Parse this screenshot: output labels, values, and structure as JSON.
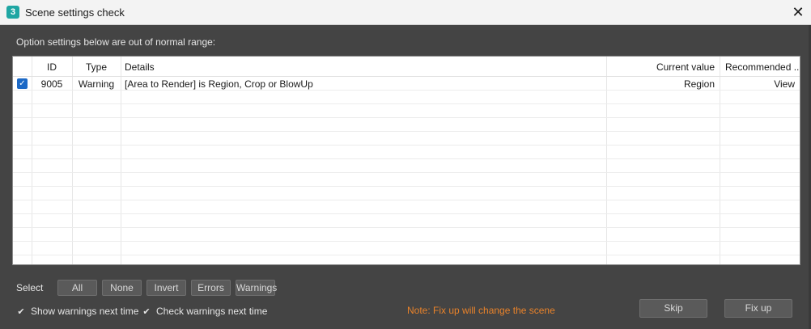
{
  "window": {
    "title": "Scene settings check",
    "app_icon_glyph": "3",
    "close_glyph": "✕"
  },
  "info_text": "Option settings below are out of normal range:",
  "table": {
    "columns": [
      "ID",
      "Type",
      "Details",
      "Current value",
      "Recommended ..."
    ],
    "rows": [
      {
        "checked": true,
        "id": "9005",
        "type": "Warning",
        "details": "[Area to Render] is Region, Crop or BlowUp",
        "current": "Region",
        "recommended": "View"
      }
    ]
  },
  "select": {
    "label": "Select",
    "buttons": [
      "All",
      "None",
      "Invert",
      "Errors",
      "Warnings"
    ]
  },
  "options": {
    "show_warnings": "Show warnings next time",
    "check_warnings": "Check warnings next time"
  },
  "note": "Note: Fix up will change the scene",
  "actions": {
    "skip": "Skip",
    "fixup": "Fix up"
  },
  "colors": {
    "dialog_bg": "#444444",
    "accent_checkbox": "#1c69c6",
    "note_orange": "#e8822a"
  }
}
